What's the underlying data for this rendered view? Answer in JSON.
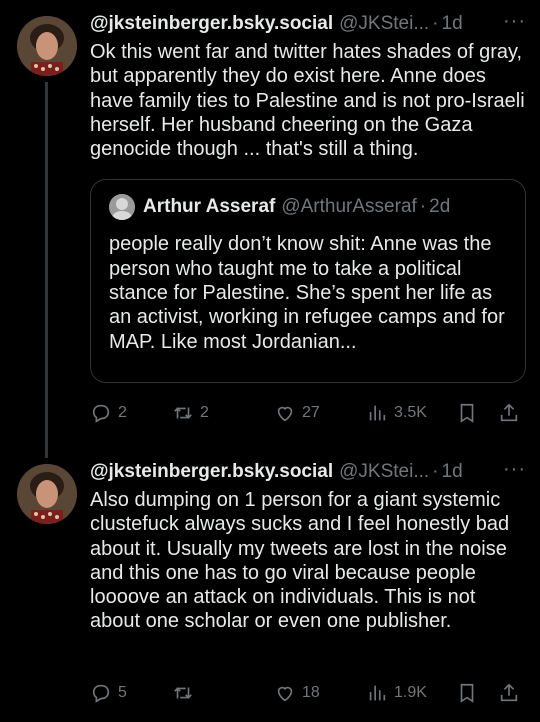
{
  "tweets": [
    {
      "display_name": "@jksteinberger.bsky.social",
      "handle": "@JKStei...",
      "dot": "·",
      "time": "1d",
      "more": "···",
      "text": "Ok this went far and twitter hates shades of gray, but apparently they do exist here. Anne does have family ties to Palestine and is not pro-Israeli herself. Her husband cheering on the Gaza genocide though ... that's still a thing.",
      "quote": {
        "display_name": "Arthur Asseraf",
        "handle": "@ArthurAsseraf",
        "dot": "·",
        "time": "2d",
        "text": "people really don’t know shit: Anne was the person who taught me to take a political stance for Palestine. She’s spent her life as an activist, working in refugee camps and for MAP. Like most Jordanian..."
      },
      "actions": {
        "replies": "2",
        "retweets": "2",
        "likes": "27",
        "views": "3.5K"
      }
    },
    {
      "display_name": "@jksteinberger.bsky.social",
      "handle": "@JKStei...",
      "dot": "·",
      "time": "1d",
      "more": "···",
      "text": "Also dumping on 1 person for a giant systemic clustefuck always sucks and I feel honestly bad about it. Usually my tweets are lost in the noise and this one has to go viral because people loooove an attack on individuals. This is not about one scholar or even one publisher.",
      "actions": {
        "replies": "5",
        "retweets": "",
        "likes": "18",
        "views": "1.9K"
      }
    }
  ],
  "icons": {
    "reply": "reply-icon",
    "retweet": "retweet-icon",
    "like": "heart-icon",
    "views": "views-icon",
    "bookmark": "bookmark-icon",
    "share": "share-icon"
  },
  "colors": {
    "background": "#000000",
    "text": "#e7e9ea",
    "muted": "#71767b",
    "border": "#2f3336"
  }
}
